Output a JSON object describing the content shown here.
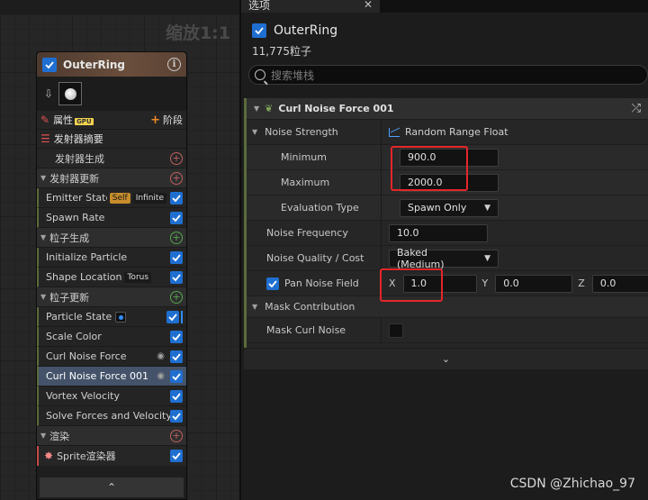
{
  "graph": {
    "zoom_label": "缩放1:1"
  },
  "node": {
    "title": "OuterRing",
    "properties_label": "属性",
    "gpu_badge": "GPU",
    "stage_label": "阶段",
    "emitter_summary_label": "发射器摘要",
    "emitter_spawn_label": "发射器生成",
    "sections": {
      "emitter_update": "发射器更新",
      "particle_spawn": "粒子生成",
      "particle_update": "粒子更新",
      "render": "渲染"
    },
    "emitter_update_items": [
      {
        "label": "Emitter State",
        "tags": [
          "Self",
          "Infinite"
        ]
      },
      {
        "label": "Spawn Rate",
        "tags": []
      }
    ],
    "particle_spawn_items": [
      {
        "label": "Initialize Particle",
        "tags": []
      },
      {
        "label": "Shape Location",
        "tags": [
          "Torus"
        ]
      }
    ],
    "particle_update_items": [
      {
        "label": "Particle State"
      },
      {
        "label": "Scale Color"
      },
      {
        "label": "Curl Noise Force"
      },
      {
        "label": "Curl Noise Force 001"
      },
      {
        "label": "Vortex Velocity"
      },
      {
        "label": "Solve Forces and Velocity"
      }
    ],
    "render_item": "Sprite渲染器"
  },
  "panel": {
    "tab_title": "选项",
    "emitter_name": "OuterRing",
    "particle_count": "11,775粒子",
    "search_placeholder": "搜索堆栈",
    "module_title": "Curl Noise Force 001",
    "rows": {
      "noise_strength": {
        "label": "Noise Strength",
        "value": "Random Range Float"
      },
      "minimum": {
        "label": "Minimum",
        "value": "900.0"
      },
      "maximum": {
        "label": "Maximum",
        "value": "2000.0"
      },
      "evaluation_type": {
        "label": "Evaluation Type",
        "value": "Spawn Only"
      },
      "noise_frequency": {
        "label": "Noise Frequency",
        "value": "10.0"
      },
      "noise_quality": {
        "label": "Noise Quality / Cost",
        "value": "Baked (Medium)"
      },
      "pan_noise_field": {
        "label": "Pan Noise Field",
        "x_label": "X",
        "x": "1.0",
        "y_label": "Y",
        "y": "0.0",
        "z_label": "Z",
        "z": "0.0"
      },
      "mask_contribution": {
        "label": "Mask Contribution"
      },
      "mask_curl_noise": {
        "label": "Mask Curl Noise"
      }
    }
  },
  "watermark": "CSDN @Zhichao_97",
  "colors": {
    "accent_blue": "#1f6fd1",
    "highlight_red": "#e4262a",
    "selected_row": "#44536a"
  }
}
